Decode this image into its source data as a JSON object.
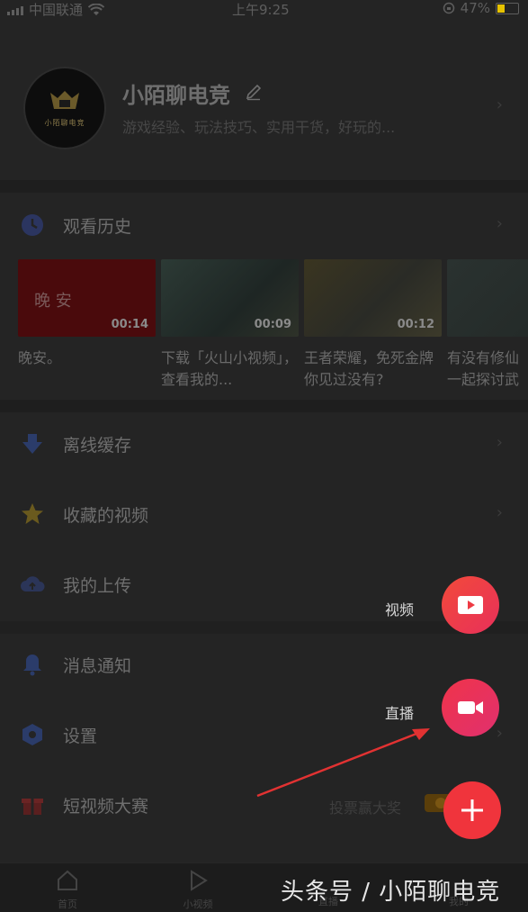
{
  "status_bar": {
    "carrier": "中国联通",
    "time": "上午9:25",
    "battery": "47%"
  },
  "profile": {
    "name": "小陌聊电竞",
    "bio": "游戏经验、玩法技巧、实用干货，好玩的...",
    "avatar_text": "小陌聊电竞"
  },
  "menu": {
    "history": "观看历史",
    "offline": "离线缓存",
    "favorites": "收藏的视频",
    "uploads": "我的上传",
    "notifications": "消息通知",
    "settings": "设置",
    "contest": "短视频大赛",
    "contest_right": "投票赢大奖"
  },
  "history_videos": [
    {
      "title": "晚安。",
      "duration": "00:14",
      "overlay": "晚 安"
    },
    {
      "title": "下载「火山小视频」，查看我的...",
      "duration": "00:09"
    },
    {
      "title": "王者荣耀，免死金牌你见过没有?",
      "duration": "00:12"
    },
    {
      "title": "有没有修仙一起探讨武",
      "duration": ""
    }
  ],
  "fab": {
    "video_label": "视频",
    "live_label": "直播"
  },
  "tabs": [
    {
      "label": "首页"
    },
    {
      "label": "小视频"
    },
    {
      "label": "直播"
    },
    {
      "label": "我的"
    }
  ],
  "watermark": "头条号 / 小陌聊电竞",
  "colors": {
    "fab_red": "#f0343c",
    "fab_live": "#e8345a",
    "overlay_bg": "#242424"
  }
}
